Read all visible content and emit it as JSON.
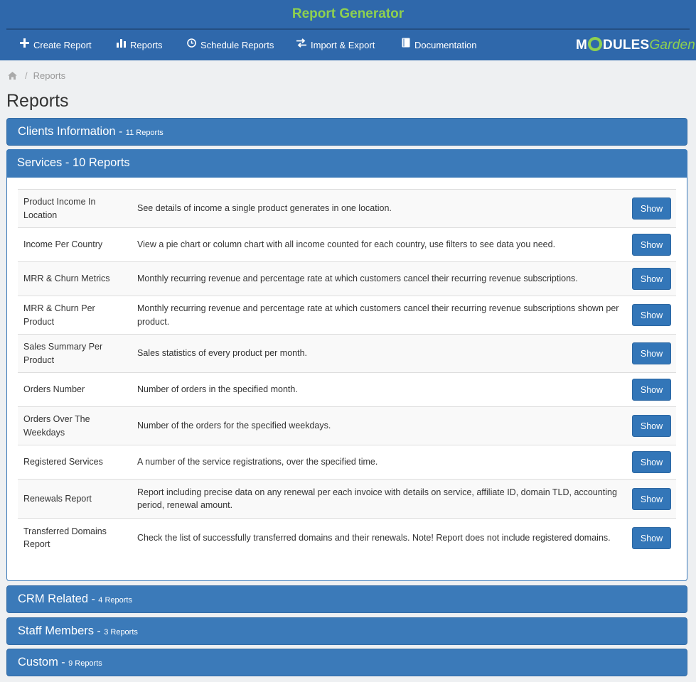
{
  "header": {
    "app_title": "Report Generator",
    "nav": [
      {
        "label": "Create Report",
        "icon": "plus-icon"
      },
      {
        "label": "Reports",
        "icon": "bar-chart-icon"
      },
      {
        "label": "Schedule Reports",
        "icon": "clock-icon"
      },
      {
        "label": "Import & Export",
        "icon": "exchange-icon"
      },
      {
        "label": "Documentation",
        "icon": "book-icon"
      }
    ],
    "logo": {
      "part1": "M",
      "part2": "DULES",
      "part3": "Garden"
    }
  },
  "breadcrumb": {
    "home_icon": "home-icon",
    "sep": "/",
    "current": "Reports"
  },
  "page_title": "Reports",
  "categories": [
    {
      "title": "Clients Information",
      "dash": " - ",
      "count": "11 Reports"
    },
    {
      "title": "Services",
      "dash": " - ",
      "count": "10 Reports"
    },
    {
      "title": "CRM Related",
      "dash": " - ",
      "count": "4 Reports"
    },
    {
      "title": "Staff Members",
      "dash": " - ",
      "count": "3 Reports"
    },
    {
      "title": "Custom",
      "dash": " - ",
      "count": "9 Reports"
    }
  ],
  "show_label": "Show",
  "services_reports": [
    {
      "name": "Product Income In Location",
      "desc": "See details of income a single product generates in one location."
    },
    {
      "name": "Income Per Country",
      "desc": "View a pie chart or column chart with all income counted for each country, use filters to see data you need."
    },
    {
      "name": "MRR & Churn Metrics",
      "desc": "Monthly recurring revenue and percentage rate at which customers cancel their recurring revenue subscriptions."
    },
    {
      "name": "MRR & Churn Per Product",
      "desc": "Monthly recurring revenue and percentage rate at which customers cancel their recurring revenue subscriptions shown per product."
    },
    {
      "name": "Sales Summary Per Product",
      "desc": "Sales statistics of every product per month."
    },
    {
      "name": "Orders Number",
      "desc": "Number of orders in the specified month."
    },
    {
      "name": "Orders Over The Weekdays",
      "desc": "Number of the orders for the specified weekdays."
    },
    {
      "name": "Registered Services",
      "desc": "A number of the service registrations, over the specified time."
    },
    {
      "name": "Renewals Report",
      "desc": "Report including precise data on any renewal per each invoice with details on service, affiliate ID, domain TLD, accounting period, renewal amount."
    },
    {
      "name": "Transferred Domains Report",
      "desc": "Check the list of successfully transferred domains and their renewals. Note! Report does not include registered domains."
    }
  ]
}
